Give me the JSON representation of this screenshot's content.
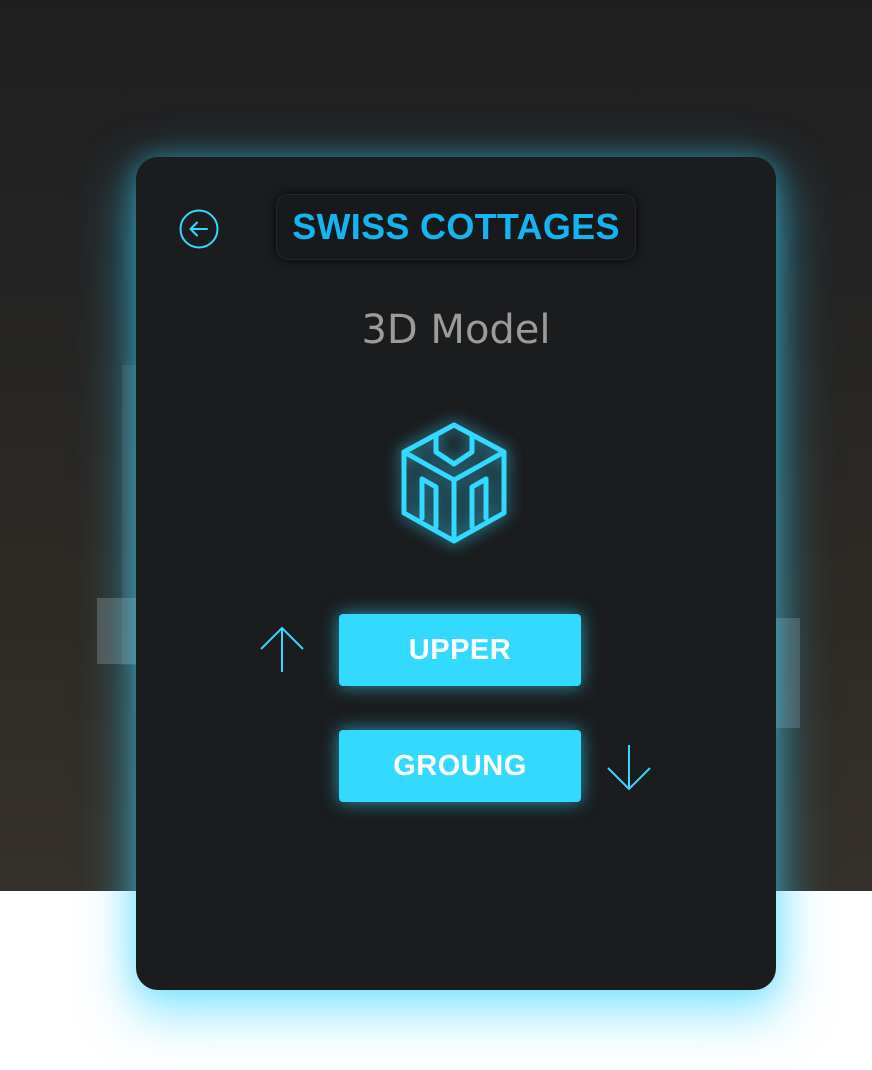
{
  "colors": {
    "accent": "#33d9ff",
    "title": "#13b5f0",
    "panel": "#1a1c1e",
    "subtitle": "#9b9b9b"
  },
  "header": {
    "back_icon": "arrow-left-circle-icon",
    "title": "SWISS COTTAGES"
  },
  "main": {
    "subtitle": "3D Model",
    "model_icon": "cube-3d-icon"
  },
  "floors": {
    "upper_label": "UPPER",
    "upper_icon": "arrow-up-icon",
    "ground_label": "GROUNG",
    "ground_icon": "arrow-down-icon"
  }
}
